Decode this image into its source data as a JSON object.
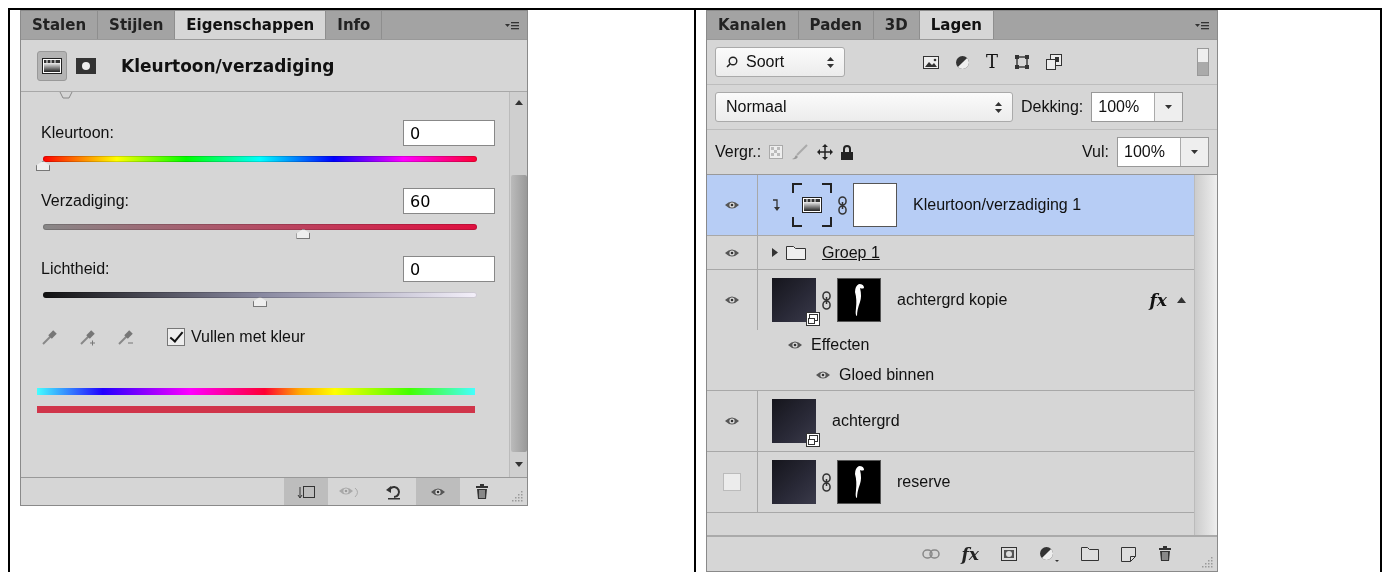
{
  "properties_panel": {
    "tabs": [
      {
        "label": "Stalen",
        "selected": false
      },
      {
        "label": "Stijlen",
        "selected": false
      },
      {
        "label": "Eigenschappen",
        "selected": true
      },
      {
        "label": "Info",
        "selected": false
      }
    ],
    "title": "Kleurtoon/verzadiging",
    "sliders": [
      {
        "kind": "hue",
        "label": "Kleurtoon:",
        "value": "0",
        "level": 0
      },
      {
        "kind": "saturation",
        "label": "Verzadiging:",
        "value": "60",
        "level": 0.6
      },
      {
        "kind": "lightness",
        "label": "Lichtheid:",
        "value": "0",
        "level": 0.5
      }
    ],
    "colorize": {
      "label": "Vullen met kleur",
      "checked": true
    }
  },
  "layers_panel": {
    "tabs": [
      {
        "label": "Kanalen",
        "selected": false
      },
      {
        "label": "Paden",
        "selected": false
      },
      {
        "label": "3D",
        "selected": false
      },
      {
        "label": "Lagen",
        "selected": true
      }
    ],
    "filter": "Soort",
    "type_filter": "T",
    "blend_mode": "Normaal",
    "opacity_label": "Dekking:",
    "opacity": "100%",
    "lock_label": "Vergr.:",
    "fill_label": "Vul:",
    "fill": "100%",
    "layers": [
      {
        "kind": "adjustment",
        "name": "Kleurtoon/verzadiging 1",
        "visible": true,
        "selected": true,
        "clipped": true,
        "has_mask": true
      },
      {
        "kind": "group",
        "name": "Groep 1",
        "visible": true,
        "selected": false,
        "expanded": false
      },
      {
        "kind": "layer",
        "name": "achtergrd kopie",
        "visible": true,
        "selected": false,
        "smart_object": true,
        "has_mask": true,
        "fx": "fx",
        "effects": {
          "label": "Effecten",
          "visible": true,
          "children": [
            {
              "label": "Gloed binnen",
              "visible": true
            }
          ]
        }
      },
      {
        "kind": "layer",
        "name": "achtergrd",
        "visible": true,
        "selected": false,
        "smart_object": true,
        "has_mask": false
      },
      {
        "kind": "layer",
        "name": "reserve",
        "visible": false,
        "selected": false,
        "smart_object": false,
        "has_mask": true
      }
    ],
    "footer_fx": "fx"
  }
}
